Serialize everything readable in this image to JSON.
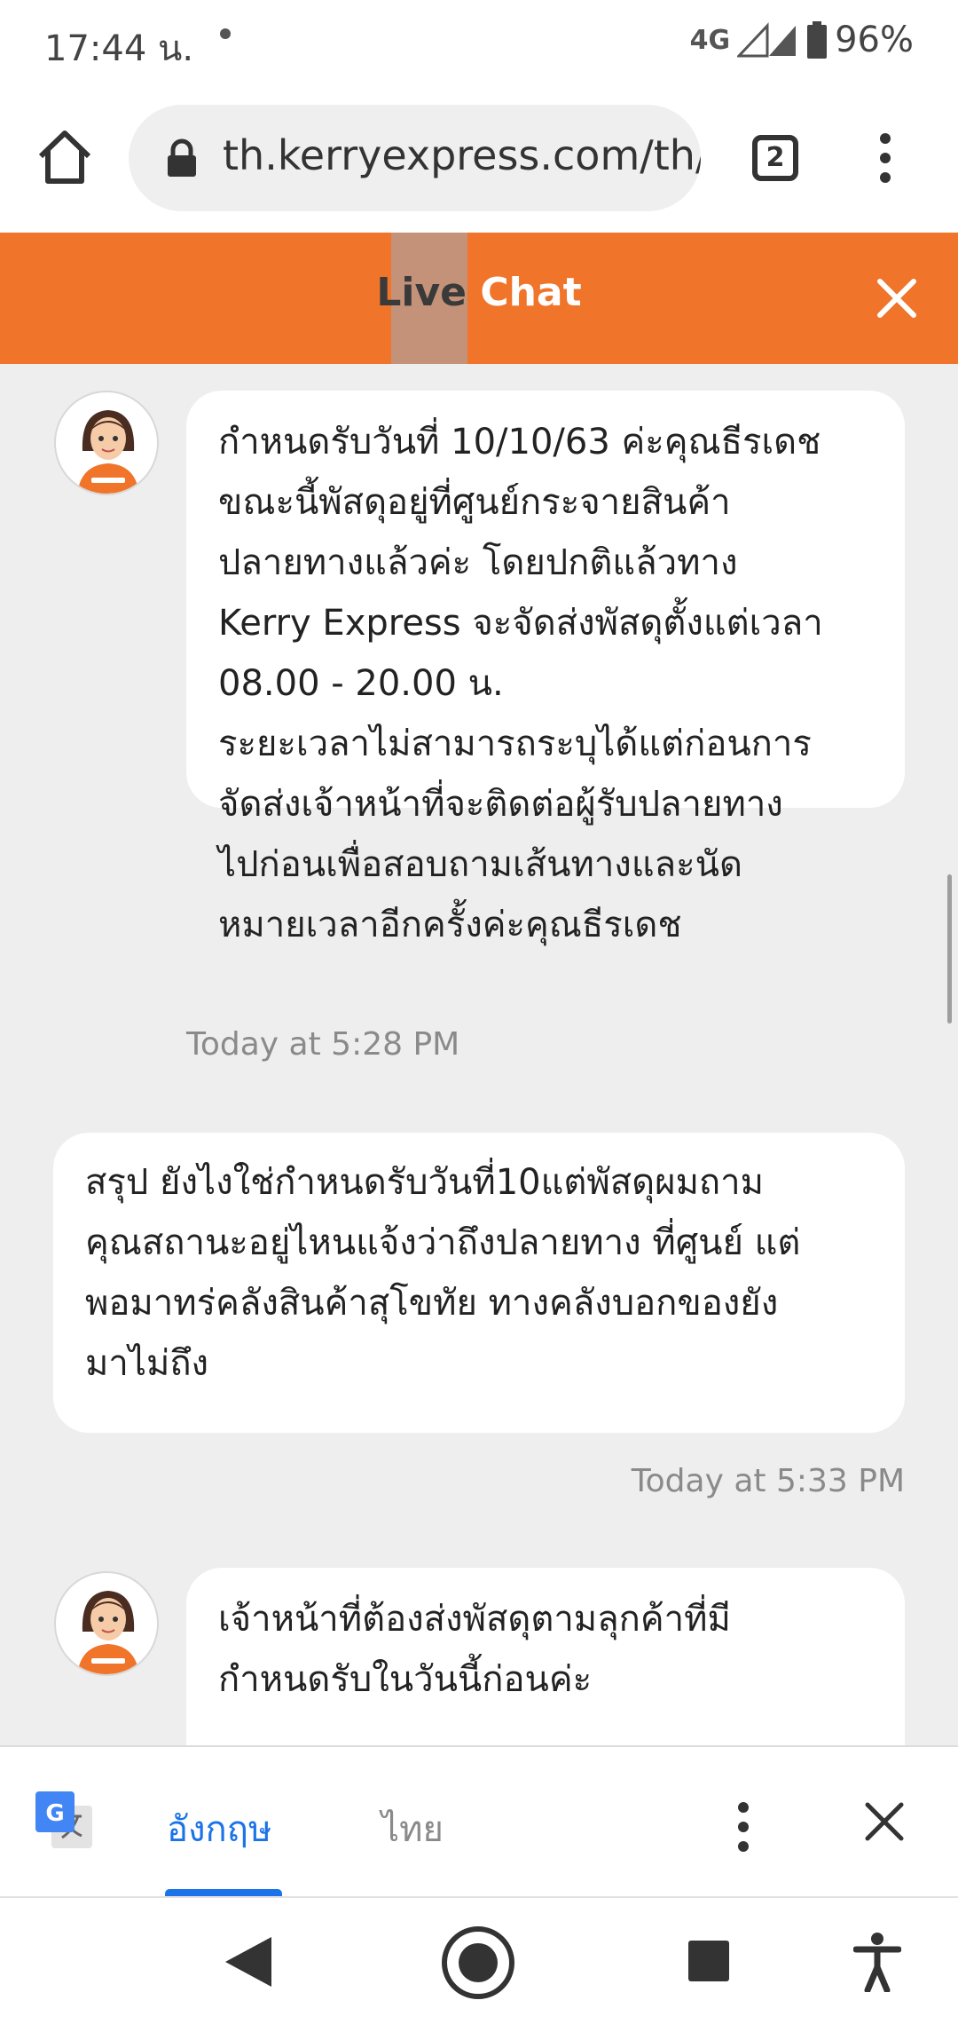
{
  "status_bar": {
    "time": "17:44 น.",
    "network": "4G",
    "battery": "96%"
  },
  "browser": {
    "url": "th.kerryexpress.com/th/",
    "tab_count": "2"
  },
  "chat_header": {
    "title_part1": "Live",
    "title_part2": "Chat"
  },
  "messages": [
    {
      "sender": "agent",
      "lines": [
        "กำหนดรับวันที่ 10/10/63 ค่ะคุณธีรเดช",
        "ขณะนี้พัสดุอยู่ที่ศูนย์กระจายสินค้า",
        "ปลายทางแล้วค่ะ โดยปกติแล้วทาง",
        "Kerry Express จะจัดส่งพัสดุตั้งแต่เวลา",
        "08.00 - 20.00 น.",
        "ระยะเวลาไม่สามารถระบุได้แต่ก่อนการ",
        "จัดส่งเจ้าหน้าที่จะติดต่อผู้รับปลายทาง",
        "ไปก่อนเพื่อสอบถามเส้นทางและนัด",
        "หมายเวลาอีกครั้งค่ะคุณธีรเดช"
      ],
      "timestamp": "Today at 5:28 PM"
    },
    {
      "sender": "user",
      "lines": [
        "สรุป ยังไงใช่กำหนดรับวันที่10แต่พัสดุผมถาม",
        "คุณสถานะอยู่ไหนแจ้งว่าถึงปลายทาง ที่ศูนย์ แต่",
        "พอมาทร่คลังสินค้าสุโขทัย ทางคลังบอกของยัง",
        "มาไม่ถึง"
      ],
      "timestamp": "Today at 5:33 PM"
    },
    {
      "sender": "agent",
      "lines": [
        "เจ้าหน้าที่ต้องส่งพัสดุตามลุกค้าที่มี",
        "กำหนดรับในวันนี้ก่อนค่ะ"
      ]
    }
  ],
  "translate_bar": {
    "source_lang": "อังกฤษ",
    "target_lang": "ไทย"
  },
  "colors": {
    "header_orange": "#f07429",
    "link_blue": "#1a73e8"
  },
  "icons": {
    "home": "home-icon",
    "lock": "lock-icon",
    "menu": "more-vert-icon",
    "close": "close-icon",
    "translate": "google-translate-icon",
    "back": "nav-back-icon",
    "nav_home": "nav-home-icon",
    "recents": "nav-recents-icon",
    "accessibility": "accessibility-icon"
  }
}
